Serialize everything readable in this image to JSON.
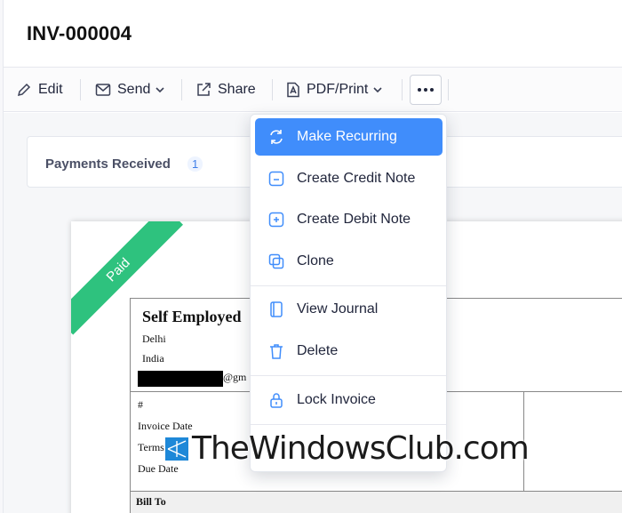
{
  "invoice": {
    "number": "INV-000004"
  },
  "toolbar": {
    "edit_label": "Edit",
    "send_label": "Send",
    "share_label": "Share",
    "pdf_label": "PDF/Print"
  },
  "payments": {
    "label": "Payments Received",
    "count": "1"
  },
  "status_ribbon": "Paid",
  "document": {
    "company": "Self Employed",
    "city": "Delhi",
    "country": "India",
    "email_tail": "@gm",
    "hash_label": "#",
    "invoice_date_label": "Invoice Date",
    "terms_label": "Terms",
    "due_date_label": "Due Date",
    "bill_to_label": "Bill To"
  },
  "menu": {
    "items": [
      {
        "label": "Make Recurring",
        "icon": "recurring-icon"
      },
      {
        "label": "Create Credit Note",
        "icon": "credit-note-icon"
      },
      {
        "label": "Create Debit Note",
        "icon": "debit-note-icon"
      },
      {
        "label": "Clone",
        "icon": "clone-icon"
      },
      {
        "label": "View Journal",
        "icon": "journal-icon"
      },
      {
        "label": "Delete",
        "icon": "trash-icon"
      },
      {
        "label": "Lock Invoice",
        "icon": "lock-icon"
      }
    ]
  },
  "watermark": {
    "text": "TheWindowsClub.com"
  },
  "colors": {
    "accent": "#408dfb",
    "paid": "#2ec27e",
    "link": "#3f7ee8"
  }
}
